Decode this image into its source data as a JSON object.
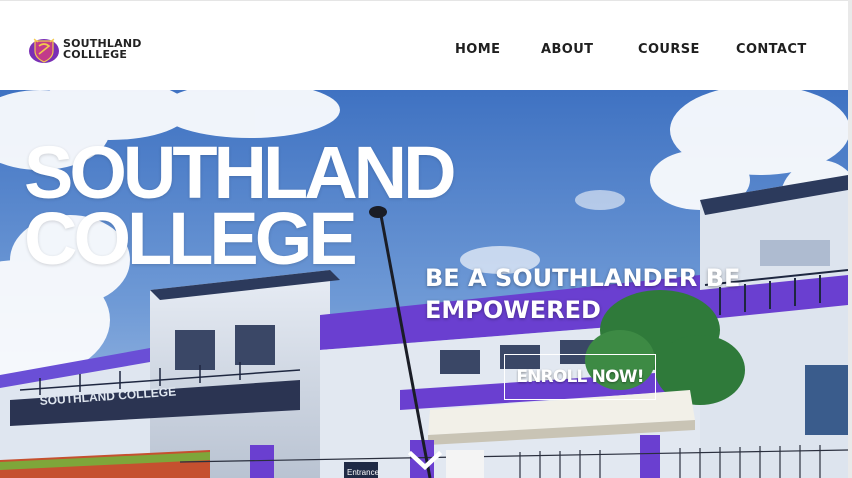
{
  "header": {
    "logo": {
      "line1": "SOUTHLAND",
      "line2": "COLLLEGE",
      "icon": "college-seal-icon"
    },
    "nav": [
      {
        "label": "HOME"
      },
      {
        "label": "ABOUT"
      },
      {
        "label": "COURSE"
      },
      {
        "label": "CONTACT"
      }
    ]
  },
  "hero": {
    "title_line1": "SOUTHLAND",
    "title_line2": "COLLEGE",
    "tagline": "BE A SOUTHLANDER BE EMPOWERED",
    "cta_label": "ENROLL NOW!",
    "scroll_icon": "chevron-down-icon",
    "building_sign": "SOUTHLAND COLLEGE",
    "gate_sign": "Entrance"
  },
  "colors": {
    "brand_purple": "#6a3fd0",
    "sky": "#5f8fd0",
    "nav_text": "#1f1f1f"
  }
}
